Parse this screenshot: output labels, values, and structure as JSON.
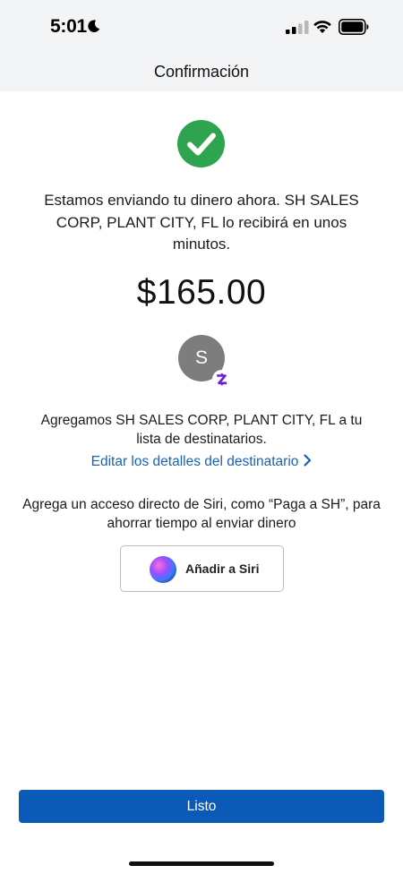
{
  "status_bar": {
    "time": "5:01"
  },
  "nav": {
    "title": "Confirmación"
  },
  "confirmation": {
    "message": "Estamos enviando tu dinero ahora. SH SALES CORP, PLANT CITY, FL lo recibirá en unos minutos.",
    "amount": "$165.00"
  },
  "recipient": {
    "avatar_initial": "S",
    "added_text": "Agregamos SH SALES CORP, PLANT CITY, FL a tu lista de destinatarios.",
    "edit_link": "Editar los detalles del destinatario"
  },
  "siri": {
    "hint": "Agrega un acceso directo de Siri, como “Paga a SH”, para ahorrar tiempo al enviar dinero",
    "button_label": "Añadir a Siri"
  },
  "footer": {
    "done_label": "Listo"
  },
  "colors": {
    "success": "#2ea44f",
    "link": "#1a63b2",
    "primary_button": "#0b5ab8",
    "zelle": "#6d1ed4"
  },
  "icons": [
    "moon-icon",
    "signal-icon",
    "wifi-icon",
    "battery-icon",
    "checkmark-circle-icon",
    "zelle-icon",
    "chevron-right-icon",
    "siri-icon"
  ]
}
